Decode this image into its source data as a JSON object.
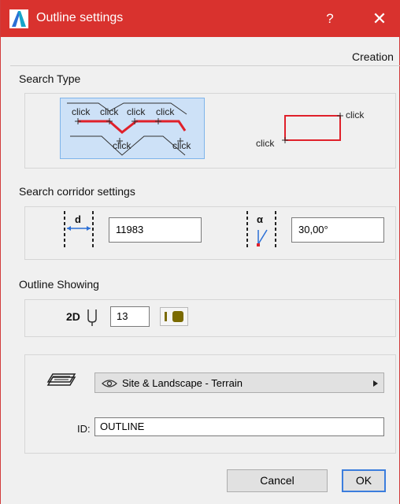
{
  "window": {
    "title": "Outline settings",
    "help_label": "?",
    "close_label": "✕",
    "accent_color": "#d9322e",
    "tab_label": "Creation"
  },
  "search_type": {
    "section_label": "Search Type",
    "polyline_option": {
      "selected": true,
      "click_labels": [
        "click",
        "click",
        "click",
        "click",
        "click",
        "click"
      ]
    },
    "rectangle_option": {
      "selected": false,
      "click_labels": [
        "click",
        "click"
      ]
    }
  },
  "corridor": {
    "section_label": "Search corridor settings",
    "width_symbol": "d",
    "width_value": "11983",
    "angle_symbol": "α",
    "angle_value": "30,00°"
  },
  "outline_showing": {
    "section_label": "Outline Showing",
    "view_label": "2D",
    "pen_value": "13",
    "pen_color": "#7a6a00"
  },
  "layer": {
    "selected_layer": "Site & Landscape - Terrain",
    "icons": [
      "layers-icon",
      "eye-icon",
      "dropdown-arrow-icon"
    ]
  },
  "id_field": {
    "label": "ID:",
    "value": "OUTLINE"
  },
  "buttons": {
    "cancel_label": "Cancel",
    "ok_label": "OK"
  }
}
